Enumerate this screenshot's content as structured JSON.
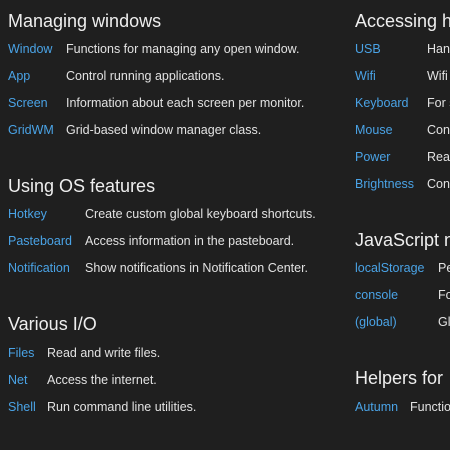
{
  "sections": {
    "windows": {
      "title": "Managing windows",
      "items": [
        {
          "name": "Window",
          "desc": "Functions for managing any open window."
        },
        {
          "name": "App",
          "desc": "Control running applications."
        },
        {
          "name": "Screen",
          "desc": "Information about each screen per monitor."
        },
        {
          "name": "GridWM",
          "desc": "Grid-based window manager class."
        }
      ]
    },
    "os": {
      "title": "Using OS features",
      "items": [
        {
          "name": "Hotkey",
          "desc": "Create custom global keyboard shortcuts."
        },
        {
          "name": "Pasteboard",
          "desc": "Access information in the pasteboard."
        },
        {
          "name": "Notification",
          "desc": "Show notifications in Notification Center."
        }
      ]
    },
    "io": {
      "title": "Various I/O",
      "items": [
        {
          "name": "Files",
          "desc": "Read and write files."
        },
        {
          "name": "Net",
          "desc": "Access the internet."
        },
        {
          "name": "Shell",
          "desc": "Run command line utilities."
        }
      ]
    },
    "hardware": {
      "title": "Accessing h",
      "items": [
        {
          "name": "USB",
          "desc": "Han"
        },
        {
          "name": "Wifi",
          "desc": "Wifi"
        },
        {
          "name": "Keyboard",
          "desc": "For s"
        },
        {
          "name": "Mouse",
          "desc": "Con"
        },
        {
          "name": "Power",
          "desc": "Read"
        },
        {
          "name": "Brightness",
          "desc": "Con"
        }
      ]
    },
    "javascript": {
      "title": "JavaScript n",
      "items": [
        {
          "name": "localStorage",
          "desc": "Pe"
        },
        {
          "name": "console",
          "desc": "Fo"
        },
        {
          "name": "(global)",
          "desc": "Gl"
        }
      ]
    },
    "helpers": {
      "title": "Helpers for",
      "items": [
        {
          "name": "Autumn",
          "desc": "Functio"
        }
      ]
    }
  }
}
